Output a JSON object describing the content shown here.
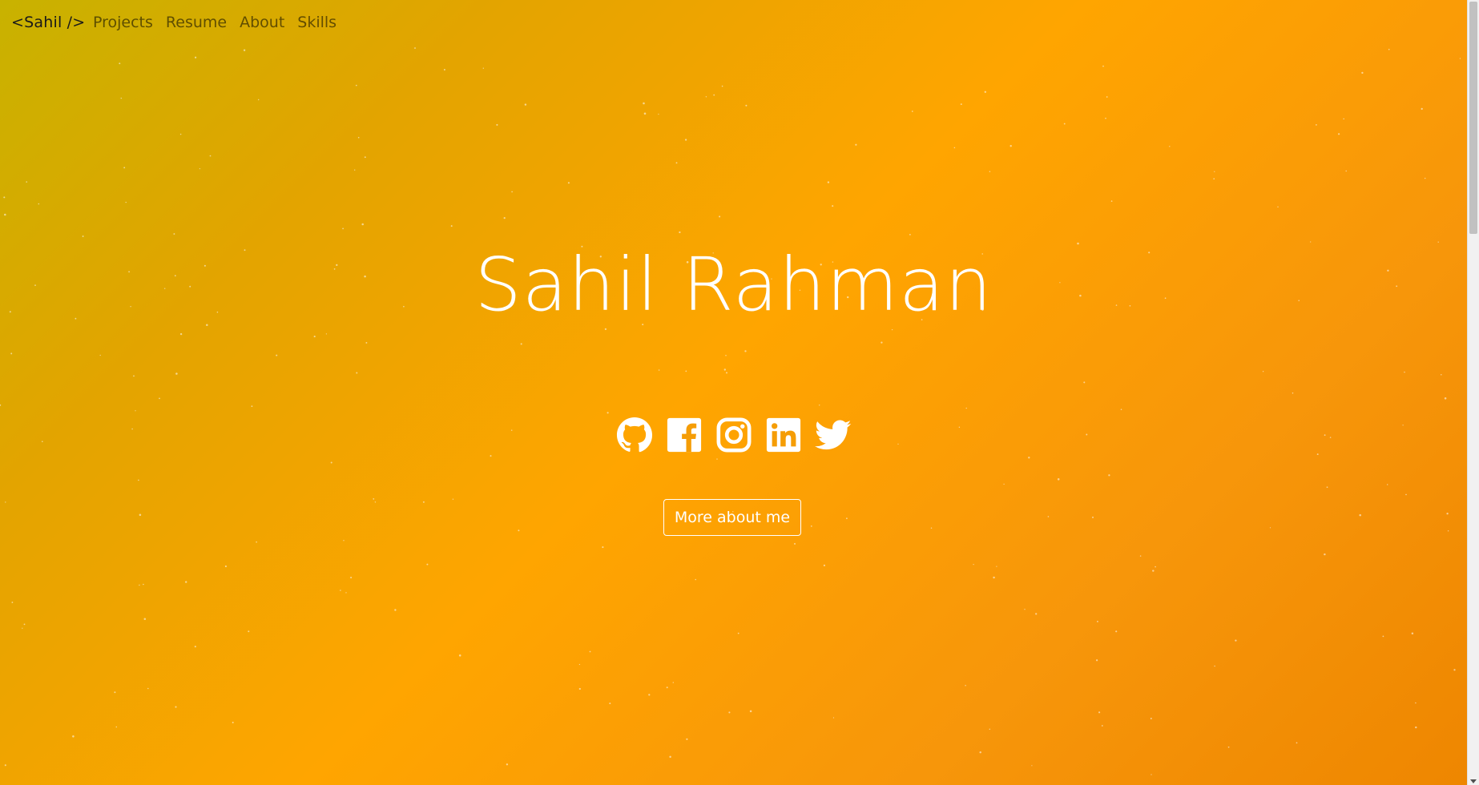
{
  "navbar": {
    "brand": "<Sahil />",
    "links": [
      {
        "label": "Projects"
      },
      {
        "label": "Resume"
      },
      {
        "label": "About"
      },
      {
        "label": "Skills"
      }
    ]
  },
  "hero": {
    "name": "Sahil Rahman",
    "social_icons": [
      "github-icon",
      "facebook-icon",
      "instagram-icon",
      "linkedin-icon",
      "twitter-icon"
    ],
    "button_label": "More about me"
  },
  "colors": {
    "background_start": "#c8b200",
    "background_mid": "#ffa500",
    "background_end": "#ee8600",
    "text": "#ffffff"
  }
}
